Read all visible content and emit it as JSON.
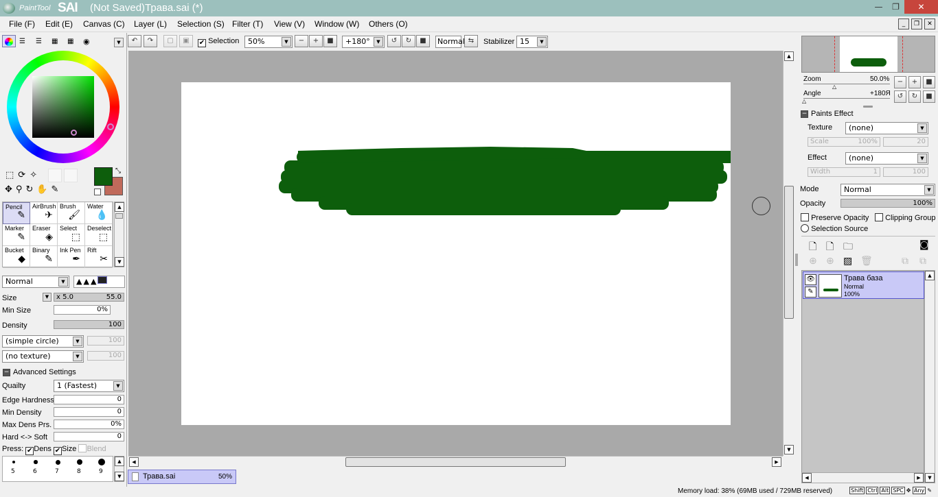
{
  "app": {
    "logo_small": "PaintTool",
    "logo_large": "SAI",
    "window_title": "(Not Saved)Трава.sai (*)",
    "window_controls": {
      "minimize": "—",
      "maximize": "❐",
      "close": "✕"
    }
  },
  "menu": [
    "File (F)",
    "Edit (E)",
    "Canvas (C)",
    "Layer (L)",
    "Selection (S)",
    "Filter (T)",
    "View (V)",
    "Window (W)",
    "Others (O)"
  ],
  "toolbar": {
    "selection_label": "Selection",
    "selection_checked": true,
    "zoom_value": "50%",
    "angle_value": "+180°",
    "blend_mode_value": "Normal",
    "stabilizer_label": "Stabilizer",
    "stabilizer_value": "15"
  },
  "colors": {
    "primary": "#0d5e0c",
    "secondary": "#c06a5b",
    "paint_stroke": "#0d5e0c",
    "titlebar": "#9cc0bd"
  },
  "tools": [
    {
      "label": "Pencil",
      "icon": "pencil-icon",
      "selected": true
    },
    {
      "label": "AirBrush",
      "icon": "airbrush-icon",
      "selected": false
    },
    {
      "label": "Brush",
      "icon": "brush-icon",
      "selected": false
    },
    {
      "label": "Water",
      "icon": "water-icon",
      "selected": false
    },
    {
      "label": "Marker",
      "icon": "marker-icon",
      "selected": false
    },
    {
      "label": "Eraser",
      "icon": "eraser-icon",
      "selected": false
    },
    {
      "label": "Select",
      "icon": "select-icon",
      "selected": false
    },
    {
      "label": "Deselect",
      "icon": "deselect-icon",
      "selected": false
    },
    {
      "label": "Bucket",
      "icon": "bucket-icon",
      "selected": false
    },
    {
      "label": "Binary",
      "icon": "binary-icon",
      "selected": false
    },
    {
      "label": "Ink Pen",
      "icon": "ink-pen-icon",
      "selected": false
    },
    {
      "label": "Rift",
      "icon": "rift-icon",
      "selected": false
    }
  ],
  "brush": {
    "blend_mode": "Normal",
    "size_label": "Size",
    "size_multiplier": "x 5.0",
    "size_value": "55.0",
    "min_size_label": "Min Size",
    "min_size_value": "0%",
    "density_label": "Density",
    "density_value": "100",
    "density_level": 1.0,
    "shape_value": "(simple circle)",
    "shape_amount": "100",
    "texture_value": "(no texture)",
    "texture_amount": "100",
    "advanced_label": "Advanced Settings",
    "quality_label": "Quailty",
    "quality_value": "1 (Fastest)",
    "edge_hardness_label": "Edge Hardness",
    "edge_hardness_value": "0",
    "min_density_label": "Min Density",
    "min_density_value": "0",
    "max_dens_label": "Max Dens Prs.",
    "max_dens_value": "0%",
    "hard_soft_label": "Hard <-> Soft",
    "hard_soft_value": "0",
    "press_label": "Press:",
    "press_dens": "Dens",
    "press_size": "Size",
    "press_blend": "Blend",
    "size_presets": [
      "5",
      "6",
      "7",
      "8",
      "9"
    ]
  },
  "navigator": {
    "zoom_label": "Zoom",
    "zoom_value": "50.0%",
    "angle_label": "Angle",
    "angle_value": "+180Я"
  },
  "paints_effect": {
    "header": "Paints Effect",
    "texture_label": "Texture",
    "texture_value": "(none)",
    "scale_label": "Scale",
    "scale_value": "100%",
    "scale_amount": "20",
    "effect_label": "Effect",
    "effect_value": "(none)",
    "width_label": "Width",
    "width_value": "1",
    "width_amount": "100"
  },
  "layer_props": {
    "mode_label": "Mode",
    "mode_value": "Normal",
    "opacity_label": "Opacity",
    "opacity_value": "100%",
    "preserve_opacity": "Preserve Opacity",
    "clipping_group": "Clipping Group",
    "selection_source": "Selection Source"
  },
  "layers": [
    {
      "name": "Трава база",
      "mode": "Normal",
      "opacity": "100%"
    }
  ],
  "document_tab": {
    "name": "Трава.sai",
    "zoom": "50%"
  },
  "status": {
    "memory": "Memory load: 38% (69MB used / 729MB reserved)",
    "keys": [
      "Shift",
      "Ctrl",
      "Alt",
      "SPC",
      "Any"
    ]
  }
}
